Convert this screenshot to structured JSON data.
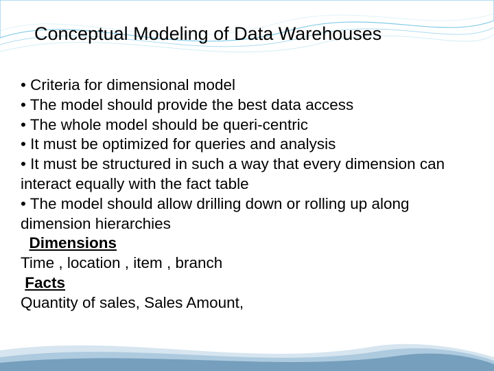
{
  "title": "Conceptual Modeling of Data Warehouses",
  "bullets": {
    "b1": "• Criteria for dimensional model",
    "b2": "• The model should provide the best data access",
    "b3": "• The whole model should be queri-centric",
    "b4": "• It must be optimized for queries and analysis",
    "b5": "• It must be structured in such a way that every dimension can interact equally with the fact table",
    "b6": "• The model should allow drilling down or rolling up along dimension hierarchies"
  },
  "sections": {
    "dimensions_heading_prefix": "  ",
    "dimensions_heading": "Dimensions",
    "dimensions_text": "Time , location , item , branch",
    "facts_heading_prefix": " ",
    "facts_heading": "Facts",
    "facts_text": "Quantity of sales, Sales Amount,"
  }
}
